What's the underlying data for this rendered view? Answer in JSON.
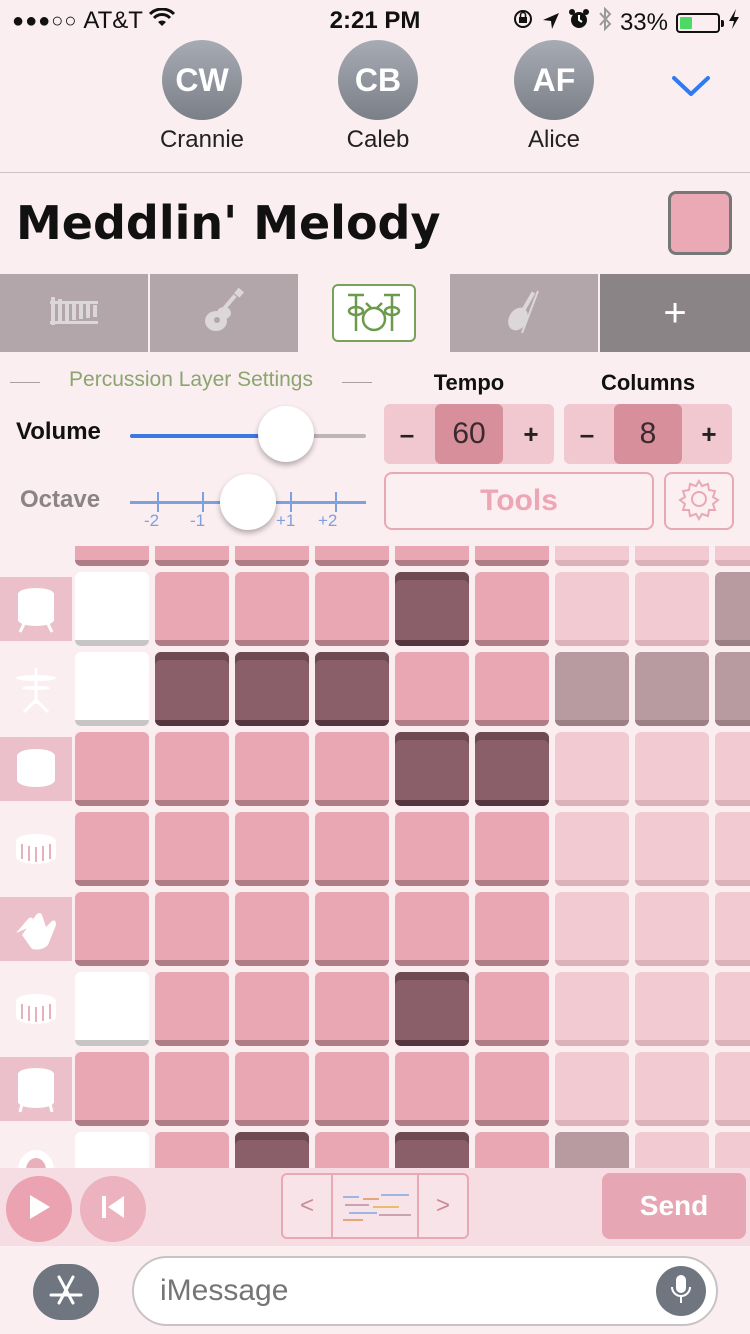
{
  "status_bar": {
    "signal": "●●●○○",
    "carrier": "AT&T",
    "time": "2:21 PM",
    "battery": "33%",
    "battery_level": 0.33,
    "icons": [
      "wifi-icon",
      "orientation-lock-icon",
      "location-icon",
      "alarm-icon",
      "bluetooth-icon",
      "charging-icon"
    ]
  },
  "contacts": [
    {
      "initials": "CW",
      "name": "Crannie"
    },
    {
      "initials": "CB",
      "name": "Caleb"
    },
    {
      "initials": "AF",
      "name": "Alice"
    }
  ],
  "song": {
    "title": "Meddlin' Melody",
    "color": "#eba9b6"
  },
  "tabs": [
    {
      "icon": "xylophone-icon",
      "active": false
    },
    {
      "icon": "guitar-icon",
      "active": false
    },
    {
      "icon": "drums-icon",
      "active": true
    },
    {
      "icon": "violin-icon",
      "active": false
    },
    {
      "label": "+",
      "icon": "add-icon"
    }
  ],
  "settings": {
    "legend": "Percussion Layer Settings",
    "volume_label": "Volume",
    "volume_value": 0.66,
    "octave_label": "Octave",
    "octave_ticks": [
      "-2",
      "-1",
      "+1",
      "+2"
    ],
    "octave_value": 0,
    "tools_label": "Tools",
    "gear_icon": "gear-icon"
  },
  "tempo": {
    "title": "Tempo",
    "minus": "–",
    "value": "60",
    "plus": "+"
  },
  "columns": {
    "title": "Columns",
    "minus": "–",
    "value": "8",
    "plus": "+"
  },
  "grid": {
    "instruments": [
      "kick-drum-icon",
      "cymbal-icon",
      "tom-icon",
      "snare-icon",
      "clap-icon",
      "snare-icon",
      "floor-tom-icon",
      "bass-drum-icon"
    ],
    "rows": [
      [
        0,
        0,
        0,
        0,
        1,
        0,
        0,
        0,
        1
      ],
      [
        0,
        1,
        1,
        1,
        0,
        0,
        1,
        1,
        1
      ],
      [
        0,
        0,
        0,
        0,
        1,
        1,
        0,
        0,
        0
      ],
      [
        0,
        0,
        0,
        0,
        0,
        0,
        0,
        0,
        0
      ],
      [
        0,
        0,
        0,
        0,
        0,
        0,
        0,
        0,
        0
      ],
      [
        0,
        0,
        0,
        0,
        1,
        0,
        0,
        0,
        0
      ],
      [
        0,
        0,
        0,
        0,
        0,
        0,
        0,
        0,
        0
      ],
      [
        0,
        0,
        1,
        0,
        1,
        0,
        1,
        0,
        0
      ]
    ],
    "current_column": 0
  },
  "player": {
    "prev": "<",
    "next": ">",
    "send": "Send"
  },
  "imessage": {
    "placeholder": "iMessage"
  }
}
